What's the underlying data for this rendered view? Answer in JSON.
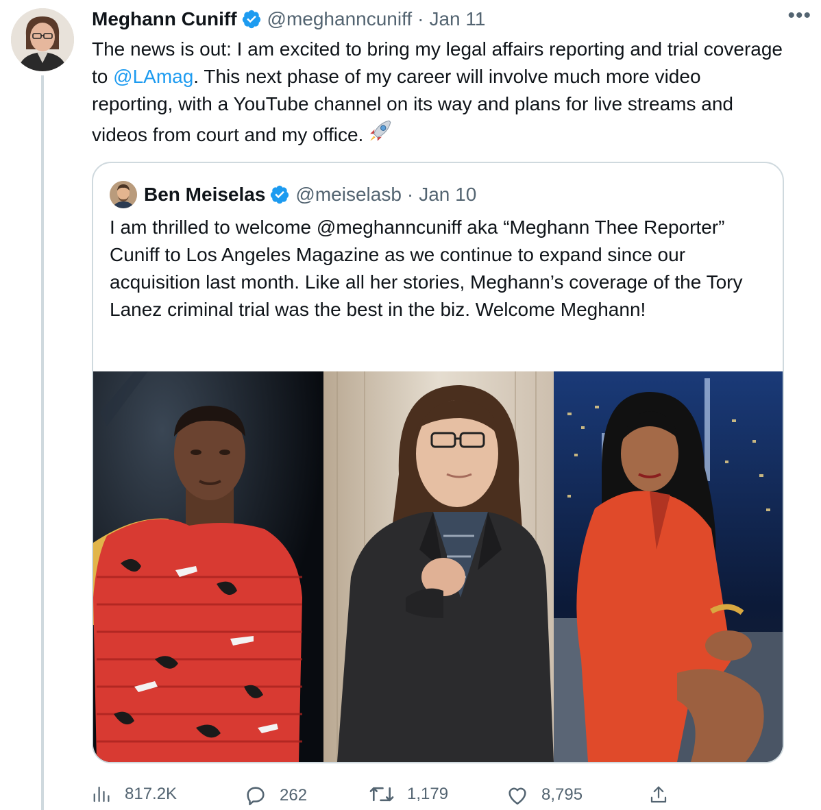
{
  "tweet": {
    "author_name": "Meghann Cuniff",
    "handle": "@meghanncuniff",
    "separator": "·",
    "date": "Jan 11",
    "more_label": "•••",
    "text_before": "The news is out: I am excited to bring my legal affairs reporting and trial coverage to ",
    "mention": "@LAmag",
    "text_after": ". This next phase of my career will involve much more video reporting, with a YouTube channel on its way and plans for live streams and videos from court and my office.",
    "emoji_icon": "rocket-icon"
  },
  "quote": {
    "author_name": "Ben Meiselas",
    "handle": "@meiselasb",
    "separator": "·",
    "date": "Jan 10",
    "text": "I am thrilled to welcome @meghanncuniff aka “Meghann Thee Reporter” Cuniff to Los Angeles Magazine as we continue to expand since our acquisition last month. Like all her stories, Meghann’s coverage of the Tory Lanez criminal trial was the best in the biz. Welcome Meghann!"
  },
  "actions": {
    "views": "817.2K",
    "replies": "262",
    "retweets": "1,179",
    "likes": "8,795"
  },
  "colors": {
    "link": "#1d9bf0",
    "secondary_text": "#536471",
    "border": "#cfd9de",
    "verified": "#1d9bf0"
  }
}
